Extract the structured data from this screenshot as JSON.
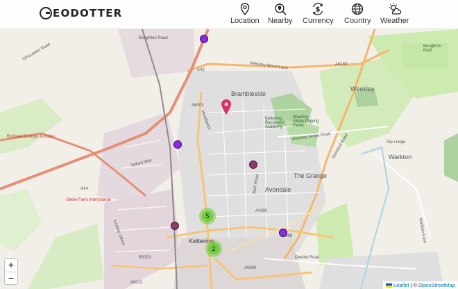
{
  "header": {
    "logo_text": "EODOTTER",
    "nav": [
      {
        "label": "Location",
        "icon": "location-pin-icon"
      },
      {
        "label": "Nearby",
        "icon": "nearby-search-icon"
      },
      {
        "label": "Currency",
        "icon": "currency-dollar-icon"
      },
      {
        "label": "Country",
        "icon": "globe-icon"
      },
      {
        "label": "Weather",
        "icon": "weather-sun-cloud-icon"
      }
    ]
  },
  "map": {
    "place_labels": {
      "brambleside": "Brambleside",
      "the_grange": "The Grange",
      "avondale": "Avondale",
      "weekley": "Weekley",
      "warkton": "Warkton",
      "kettering": "Kettering",
      "kettering_academy": "Kettering Buccleuch Academy",
      "weekley_fields": "Weekley Glebe Playing Fields",
      "boughton_park": "Boughton Park",
      "rothwell_junction": "Rothwell Grange Junction",
      "glebe_farm": "Glebe Farm Interchange"
    },
    "road_labels": {
      "a43": "A43",
      "a6003": "A6003",
      "a14": "A14",
      "a4300": "A4300",
      "a6900": "A6900",
      "a6183": "A6183",
      "b5323": "B5323",
      "a6013": "A6013",
      "a5098": "A5098",
      "weekley_wood": "Weekley Wood Lane",
      "weekley_glebe": "Weekley Glebe Road",
      "deeble": "Deeble Road",
      "warkton_lane": "Warkton Lane",
      "stamford": "Stamford Road",
      "bath_road": "Bath Road",
      "headlands": "Headlands",
      "lindsay": "Lindsay Street",
      "telford": "Telford Way",
      "gloucester": "Gloucester Road",
      "boughton": "Boughton Road",
      "top_lodge": "Top Lodge"
    },
    "clusters": [
      {
        "count": "5"
      },
      {
        "count": "2"
      }
    ],
    "marker_color_purple": "#8a2be2",
    "marker_color_maroon": "#8b3a6b",
    "pin_color": "#d6336c"
  },
  "controls": {
    "zoom_in": "+",
    "zoom_out": "−"
  },
  "attribution": {
    "leaflet": "Leaflet",
    "separator": "| ©",
    "osm": "OpenStreetMap"
  }
}
